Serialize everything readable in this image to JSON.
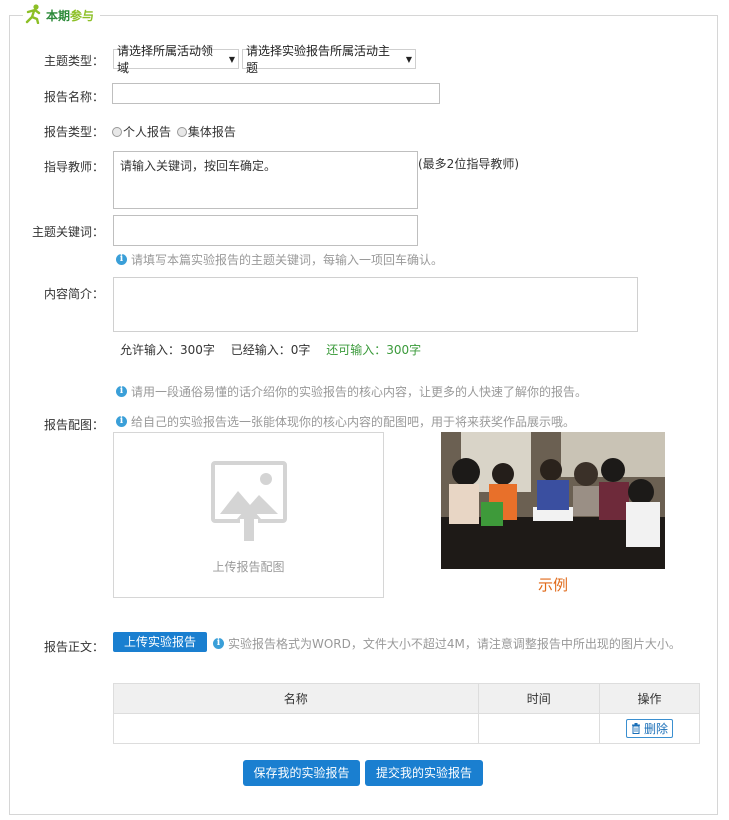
{
  "section_title_part1": "本期",
  "section_title_part2": "参与",
  "fields": {
    "theme_type_label": "主题类型：",
    "domain_select": "请选择所属活动领域",
    "topic_select": "请选择实验报告所属活动主题",
    "report_name_label": "报告名称：",
    "report_type_label": "报告类型：",
    "report_type_personal": "个人报告",
    "report_type_group": "集体报告",
    "teacher_label": "指导教师：",
    "teacher_placeholder": "请输入关键词，按回车确定。",
    "teacher_note": "(最多2位指导教师)",
    "keywords_label": "主题关键词：",
    "keywords_hint": "请填写本篇实验报告的主题关键词，每输入一项回车确认。",
    "summary_label": "内容简介：",
    "allowed": "允许输入：300字",
    "entered": "已经输入：0字",
    "remaining": "还可输入：300字",
    "summary_hint": "请用一段通俗易懂的话介绍你的实验报告的核心内容，让更多的人快速了解你的报告。",
    "cover_label": "报告配图：",
    "cover_hint": "给自己的实验报告选一张能体现你的核心内容的配图吧，用于将来获奖作品展示哦。",
    "upload_cover_text": "上传报告配图",
    "example_label": "示例",
    "body_label": "报告正文：",
    "upload_report_button": "上传实验报告",
    "body_hint": "实验报告格式为WORD，文件大小不超过4M，请注意调整报告中所出现的图片大小。"
  },
  "table": {
    "headers": [
      "名称",
      "时间",
      "操作"
    ],
    "delete_label": "删除"
  },
  "buttons": {
    "save": "保存我的实验报告",
    "submit": "提交我的实验报告"
  },
  "colors": {
    "accent_blue": "#1a7fd0",
    "green_text": "#3a9a3a",
    "example_orange": "#e06a1a"
  }
}
